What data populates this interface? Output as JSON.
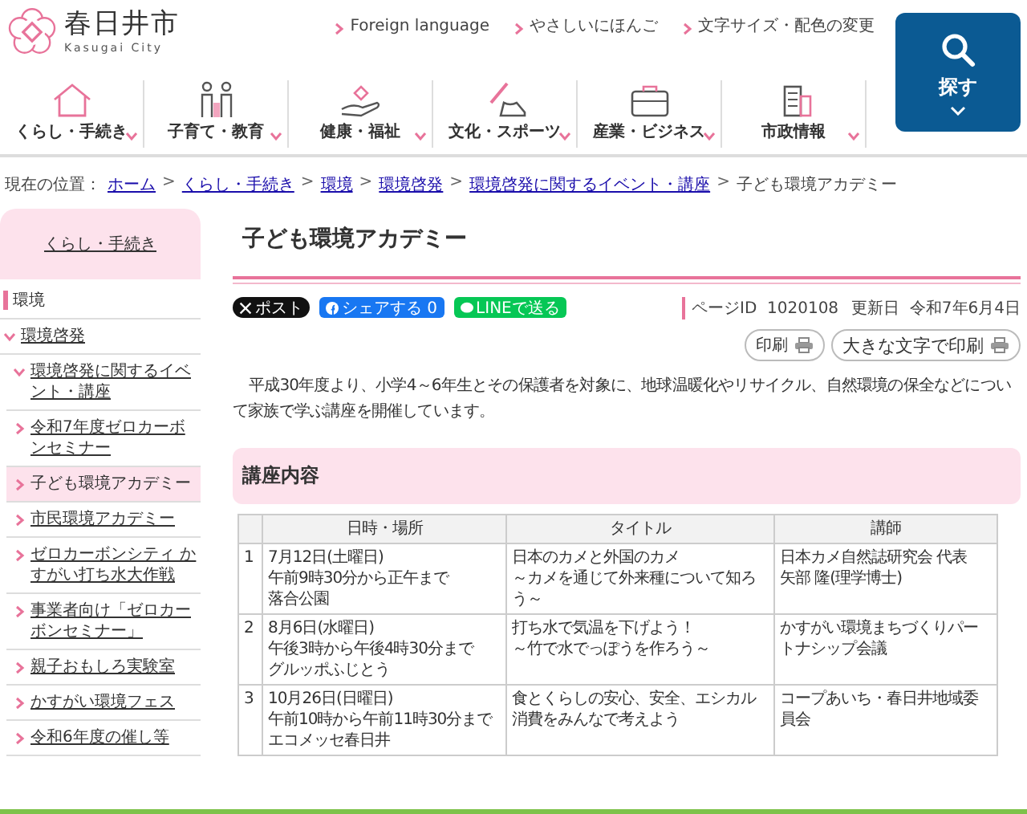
{
  "header": {
    "logo_title": "春日井市",
    "logo_subtitle": "Kasugai City",
    "utility_links": [
      "Foreign language",
      "やさしいにほんご",
      "文字サイズ・配色の変更"
    ],
    "search_button": "探す"
  },
  "nav": [
    {
      "label": "くらし・手続き"
    },
    {
      "label": "子育て・教育"
    },
    {
      "label": "健康・福祉"
    },
    {
      "label": "文化・スポーツ"
    },
    {
      "label": "産業・ビジネス"
    },
    {
      "label": "市政情報"
    }
  ],
  "breadcrumb": {
    "label": "現在の位置：",
    "separator": ">",
    "items": [
      {
        "text": "ホーム",
        "link": true
      },
      {
        "text": "くらし・手続き",
        "link": true
      },
      {
        "text": "環境",
        "link": true
      },
      {
        "text": "環境啓発",
        "link": true
      },
      {
        "text": "環境啓発に関するイベント・講座",
        "link": true
      },
      {
        "text": "子ども環境アカデミー",
        "link": false
      }
    ]
  },
  "sidebar": {
    "heading": "くらし・手続き",
    "items": [
      {
        "label": "環境",
        "children": [
          {
            "label": "環境啓発",
            "expanded": true,
            "children": [
              {
                "label": "環境啓発に関するイベント・講座",
                "expanded": true,
                "children": [
                  {
                    "label": "令和7年度ゼロカーボンセミナー",
                    "selected": false
                  },
                  {
                    "label": "子ども環境アカデミー",
                    "selected": true
                  },
                  {
                    "label": "市民環境アカデミー",
                    "selected": false
                  },
                  {
                    "label": "ゼロカーボンシティ かすがい打ち水大作戦",
                    "selected": false
                  },
                  {
                    "label": "事業者向け「ゼロカーボンセミナー」",
                    "selected": false
                  },
                  {
                    "label": "親子おもしろ実験室",
                    "selected": false
                  },
                  {
                    "label": "かすがい環境フェス",
                    "selected": false
                  },
                  {
                    "label": "令和6年度の催し等",
                    "selected": false
                  }
                ]
              }
            ]
          }
        ]
      }
    ]
  },
  "page": {
    "title": "子ども環境アカデミー",
    "share_buttons": [
      {
        "kind": "x",
        "label": "ポスト"
      },
      {
        "kind": "facebook",
        "label": "シェアする 0"
      },
      {
        "kind": "line",
        "label": "LINEで送る"
      }
    ],
    "page_id_label": "ページID",
    "page_id": "1020108",
    "updated_label": "更新日",
    "updated": "令和7年6月4日",
    "print_buttons": [
      {
        "label": "印刷"
      },
      {
        "label": "大きな文字で印刷"
      }
    ],
    "intro": "平成30年度より、小学4～6年生とその保護者を対象に、地球温暖化やリサイクル、自然環境の保全などについて家族で学ぶ講座を開催しています。",
    "section_heading": "講座内容",
    "table": {
      "columns": [
        "日時・場所",
        "タイトル",
        "講師"
      ],
      "rows": [
        {
          "number": "1",
          "date_place": [
            "7月12日(土曜日)",
            "午前9時30分から正午まで",
            "落合公園"
          ],
          "title": [
            "日本のカメと外国のカメ",
            "～カメを通じて外来種について知ろう～"
          ],
          "lecturer": [
            "日本カメ自然誌研究会 代表",
            "矢部 隆(理学博士)"
          ]
        },
        {
          "number": "2",
          "date_place": [
            "8月6日(水曜日)",
            "午後3時から午後4時30分まで",
            "グルッポふじとう"
          ],
          "title": [
            "打ち水で気温を下げよう！",
            "～竹で水でっぽうを作ろう～"
          ],
          "lecturer": [
            "かすがい環境まちづくりパートナシップ会議"
          ]
        },
        {
          "number": "3",
          "date_place": [
            "10月26日(日曜日)",
            "午前10時から午前11時30分まで",
            "エコメッセ春日井"
          ],
          "title": [
            "食とくらしの安心、安全、エシカル消費をみんなで考えよう"
          ],
          "lecturer": [
            "コープあいち・春日井地域委員会"
          ]
        }
      ]
    }
  }
}
